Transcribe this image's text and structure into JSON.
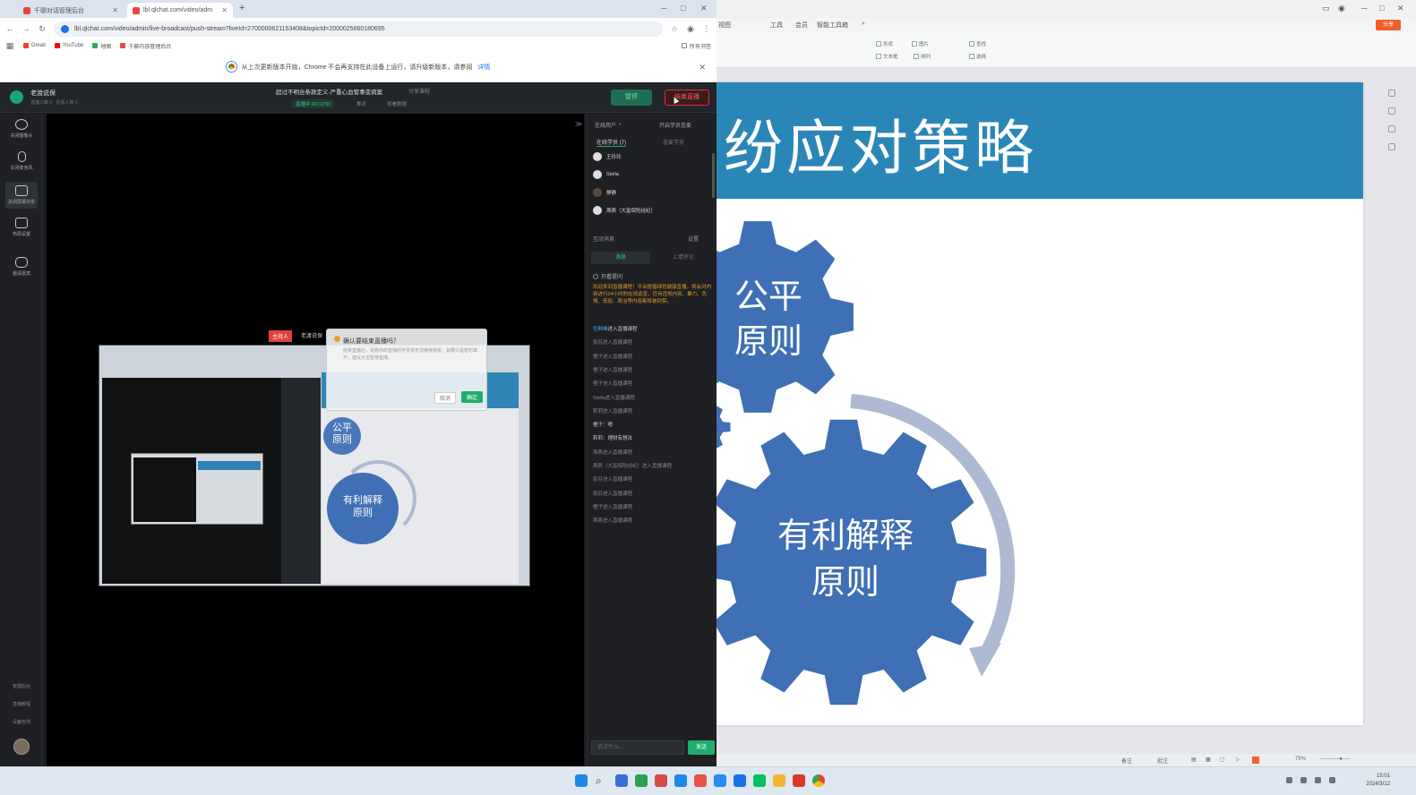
{
  "browser": {
    "tabs": [
      {
        "title": "千聊对话管理后台",
        "active": false
      },
      {
        "title": "lbl.qlchat.com/video/adm",
        "active": true
      }
    ],
    "new_tab": "+",
    "url": "lbl.qlchat.com/video/admin/live-broadcast/push-stream?liveId=2700000621153408&topicId=2000025660180695",
    "bookmarks": [
      "Gmail",
      "YouTube",
      "地图",
      "千聊内容管理后台"
    ],
    "bookmarks_right": "所有书签",
    "infobar_text": "从上次更新版本开始，Chrome 不会再支持在此设备上运行，请升级新版本，请参阅",
    "infobar_link": "详情",
    "window_controls": [
      "─",
      "□",
      "✕"
    ]
  },
  "live_console": {
    "brand_name": "老渡说保",
    "brand_sub": "直播人数 0  ·  在线人数 0",
    "session_title": "超过不明合条款定义·严重心血管事变病案",
    "share_link": "分享课程",
    "live_status": "直播中 00:12:50",
    "meta1": "推流",
    "meta2": "观看数据",
    "pause_label": "暂停",
    "end_label": "结束直播",
    "left_nav": [
      {
        "label": "关闭摄像头",
        "active": false
      },
      {
        "label": "关闭麦克风",
        "active": false
      },
      {
        "label": "关闭屏幕共享",
        "active": true
      },
      {
        "label": "布局设置",
        "active": false
      },
      {
        "label": "邀请嘉宾",
        "active": false
      }
    ],
    "left_bottom": [
      "管理后台",
      "直播教程",
      "设备检测"
    ],
    "host_tag": "主持人",
    "host_name": "老渡说保",
    "dialog": {
      "title": "确认要结束直播吗？",
      "body": "结束直播后，观看你的直播的学员将无法继续观看；如果只是暂时离开，建议点击暂停直播。",
      "cancel": "取消",
      "ok": "确定"
    },
    "shared_slide": {
      "gear1": "公平\n原则",
      "gear2": "有利解释\n原则"
    },
    "right_panel": {
      "top_left": "在线用户 ⌃",
      "top_right": "开启学员连麦",
      "tabs": [
        {
          "label": "在线学员 (7)",
          "active": true
        },
        {
          "label": "连麦学员",
          "active": false
        }
      ],
      "viewers": [
        "王玲玲",
        "Stella",
        "静静",
        "燕燕（大富保险经纪）"
      ],
      "section_title": "互动消息",
      "section_right": "设置",
      "chat_tabs": [
        {
          "label": "消息",
          "active": true
        },
        {
          "label": "上墙评论",
          "active": false
        }
      ],
      "only_questions": "只看提问",
      "notice": "欢迎来到直播课程！平台提倡绿色健康直播，将会对内容进行24小时的在线巡查，任何违规内容、暴力、色情、低俗、政治等内容都将被封禁。",
      "chat": [
        {
          "who": "任群峰",
          "text": "进入直播课程",
          "hi": true
        },
        {
          "who": "",
          "text": "张芬进入直播课程",
          "hi": false
        },
        {
          "who": "",
          "text": "橙子进入直播课程",
          "hi": false
        },
        {
          "who": "",
          "text": "橙子进入直播课程",
          "hi": false
        },
        {
          "who": "",
          "text": "橙子进入直播课程",
          "hi": false
        },
        {
          "who": "",
          "text": "Stella进入直播课程",
          "hi": false
        },
        {
          "who": "",
          "text": "莉莉进入直播课程",
          "hi": false
        },
        {
          "who": "",
          "text": "橙子：嗯",
          "hi": true
        },
        {
          "who": "",
          "text": "莉莉：理财有想法",
          "hi": true
        },
        {
          "who": "",
          "text": "燕燕进入直播课程",
          "hi": false
        },
        {
          "who": "",
          "text": "燕燕（大富保险经纪）进入直播课程",
          "hi": false
        },
        {
          "who": "",
          "text": "张芬进入直播课程",
          "hi": false
        },
        {
          "who": "",
          "text": "张芬进入直播课程",
          "hi": false
        },
        {
          "who": "",
          "text": "橙子进入直播课程",
          "hi": false
        },
        {
          "who": "",
          "text": "燕燕进入直播课程",
          "hi": false
        }
      ],
      "input_placeholder": "说点什么...",
      "send_label": "发送"
    }
  },
  "presentation": {
    "ribbon_tabs": [
      "视图",
      "工具",
      "会员",
      "智能工具箱"
    ],
    "ribbon_buttons": [
      "形状",
      "图片",
      "查找",
      "文本框",
      "排列",
      "选择"
    ],
    "share_label": "分享",
    "slide_title": "合同解释纠纷应对策略",
    "gear_small": "公平\n原则",
    "gear_big": "有利解释\n原则",
    "status_items": [
      "备注",
      "批注",
      "75%"
    ],
    "colors": {
      "band": "#2B86B8",
      "gear": "#3F6FB4",
      "arrow": "#AEB9D2"
    }
  },
  "taskbar": {
    "time": "15:01",
    "date": "2024/3/12"
  }
}
